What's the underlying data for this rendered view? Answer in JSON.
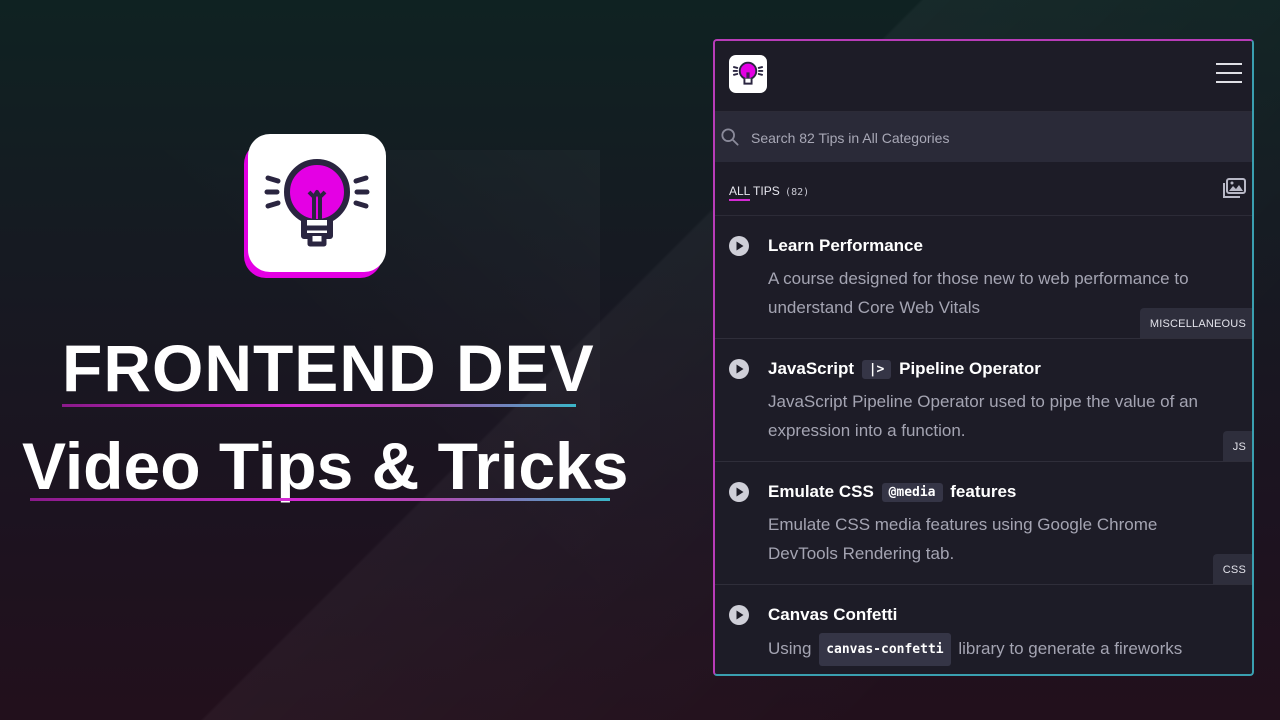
{
  "hero": {
    "line1": "FRONTEND DEV",
    "line2": "Video Tips & Tricks"
  },
  "colors": {
    "accent": "#e400e4",
    "panel_bg": "#1d1c27",
    "search_bg": "#2a2a38",
    "badge_bg": "#2e2e3c"
  },
  "panel": {
    "search": {
      "placeholder": "Search 82 Tips in All Categories"
    },
    "filter": {
      "all": "ALL",
      "label": "TIPS",
      "count": "(82)"
    },
    "tips": [
      {
        "title": "Learn Performance",
        "description": "A course designed for those new to web performance to understand Core Web Vitals",
        "category": "MISCELLANEOUS"
      },
      {
        "title_before": "JavaScript",
        "title_code": "|>",
        "title_after": "Pipeline Operator",
        "description": "JavaScript Pipeline Operator used to pipe the value of an expression into a function.",
        "category": "JS"
      },
      {
        "title_before": "Emulate CSS",
        "title_code": "@media",
        "title_after": "features",
        "description": "Emulate CSS media features using Google Chrome DevTools Rendering tab.",
        "category": "CSS"
      },
      {
        "title": "Canvas Confetti",
        "desc_before": "Using",
        "desc_code": "canvas-confetti",
        "desc_after": "library to generate a fireworks effect in your browser via confetti animations"
      }
    ]
  }
}
